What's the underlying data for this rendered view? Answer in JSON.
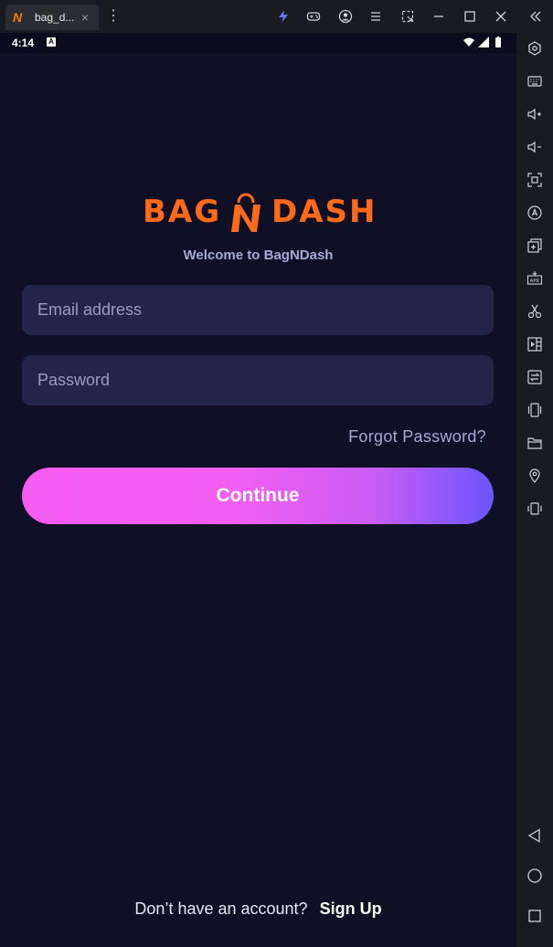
{
  "emulator": {
    "tab_title": "bag_d...",
    "tab_logo": "N",
    "tab_close": "×",
    "kebab": "⋮",
    "toolbar_icons": [
      "bolt-icon",
      "gamepad-icon",
      "account-icon",
      "menu-icon",
      "expand-icon",
      "minimize-icon",
      "maximize-icon",
      "close-icon",
      "collapse-sidebar-icon"
    ],
    "sidebar_icons": [
      "settings-hex-icon",
      "keyboard-icon",
      "volume-up-icon",
      "volume-down-icon",
      "screenshot-icon",
      "rotate-a-icon",
      "multi-instance-icon",
      "apk-icon",
      "scissors-icon",
      "media-icon",
      "sync-icon",
      "shake-icon",
      "folder-icon",
      "location-icon",
      "rotate-screen-icon",
      "back-icon",
      "home-icon",
      "recents-icon"
    ]
  },
  "status_bar": {
    "time": "4:14",
    "badge": "A"
  },
  "app": {
    "brand_name_left": "BAG",
    "brand_name_right": "DASH",
    "welcome_text": "Welcome to BagNDash",
    "email_placeholder": "Email address",
    "password_placeholder": "Password",
    "forgot_password": "Forgot Password?",
    "continue_label": "Continue",
    "signup_question": "Don’t have an account?",
    "signup_link": "Sign Up"
  },
  "colors": {
    "background": "#0f0f25",
    "field_bg": "#23244a",
    "brand_orange": "#ff6a1a",
    "button_gradient_start": "#f55cf2",
    "button_gradient_end": "#6c55ff"
  }
}
